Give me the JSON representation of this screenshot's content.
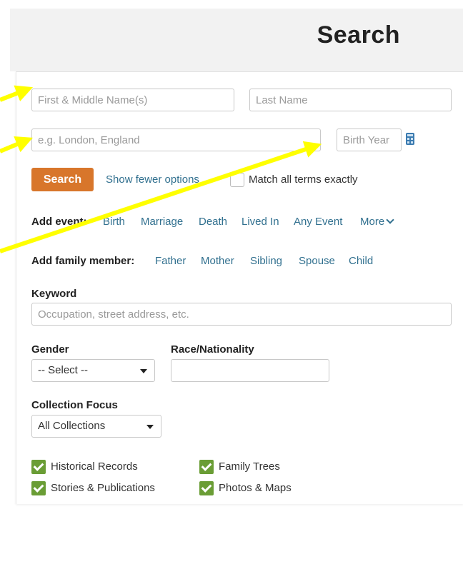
{
  "header": {
    "title": "Search"
  },
  "name": {
    "first_placeholder": "First & Middle Name(s)",
    "last_placeholder": "Last Name"
  },
  "place": {
    "placeholder": "e.g. London, England"
  },
  "birth_year": {
    "placeholder": "Birth Year",
    "icon": "calculator-icon"
  },
  "actions": {
    "search_label": "Search",
    "fewer_options": "Show fewer options",
    "match_exact": "Match all terms exactly"
  },
  "events": {
    "label": "Add event:",
    "items": [
      "Birth",
      "Marriage",
      "Death",
      "Lived In",
      "Any Event"
    ],
    "more": "More"
  },
  "family": {
    "label": "Add family member:",
    "items": [
      "Father",
      "Mother",
      "Sibling",
      "Spouse",
      "Child"
    ]
  },
  "keyword": {
    "label": "Keyword",
    "placeholder": "Occupation, street address, etc."
  },
  "gender": {
    "label": "Gender",
    "selected": "-- Select --"
  },
  "race": {
    "label": "Race/Nationality",
    "value": ""
  },
  "collection_focus": {
    "label": "Collection Focus",
    "selected": "All Collections"
  },
  "collections": [
    {
      "label": "Historical Records",
      "checked": true
    },
    {
      "label": "Family Trees",
      "checked": true
    },
    {
      "label": "Stories & Publications",
      "checked": true
    },
    {
      "label": "Photos & Maps",
      "checked": true
    }
  ],
  "colors": {
    "accent": "#d8762b",
    "link": "#31708f",
    "check": "#6a9d35",
    "annotation_arrow": "#ffff00"
  }
}
